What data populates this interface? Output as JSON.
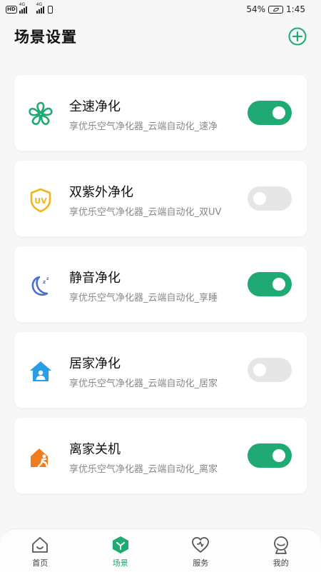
{
  "status_bar": {
    "hd": "HD",
    "net1": "4G",
    "net2": "4G",
    "battery_text": "54%",
    "time": "1:45"
  },
  "header": {
    "title": "场景设置"
  },
  "scenes": [
    {
      "title": "全速净化",
      "subtitle": "享优乐空气净化器_云端自动化_速净",
      "enabled": true,
      "icon": "fan-icon"
    },
    {
      "title": "双紫外净化",
      "subtitle": "享优乐空气净化器_云端自动化_双UV",
      "enabled": false,
      "icon": "uv-shield-icon"
    },
    {
      "title": "静音净化",
      "subtitle": "享优乐空气净化器_云端自动化_享睡",
      "enabled": true,
      "icon": "moon-sleep-icon"
    },
    {
      "title": "居家净化",
      "subtitle": "享优乐空气净化器_云端自动化_居家",
      "enabled": false,
      "icon": "home-person-icon"
    },
    {
      "title": "离家关机",
      "subtitle": "享优乐空气净化器_云端自动化_离家",
      "enabled": true,
      "icon": "leave-home-icon"
    }
  ],
  "bottom_nav": [
    {
      "label": "首页",
      "icon": "home-icon",
      "active": false
    },
    {
      "label": "场景",
      "icon": "scene-icon",
      "active": true
    },
    {
      "label": "服务",
      "icon": "heart-icon",
      "active": false
    },
    {
      "label": "我的",
      "icon": "profile-icon",
      "active": false
    }
  ],
  "colors": {
    "accent": "#1faa72",
    "toggle_off": "#e6e6e6"
  }
}
